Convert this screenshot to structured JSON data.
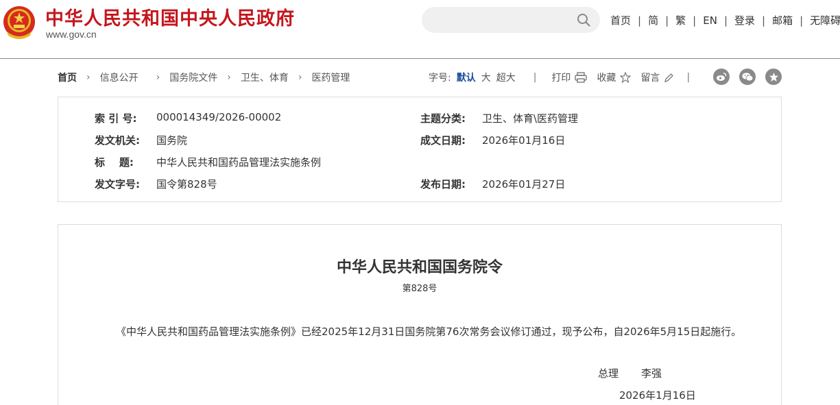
{
  "header": {
    "site_title": "中华人民共和国中央人民政府",
    "site_url": "www.gov.cn",
    "nav": [
      "首页",
      "简",
      "繁",
      "EN",
      "登录",
      "邮箱",
      "无障碍"
    ],
    "brand_color": "#c4161c"
  },
  "breadcrumb": [
    "首页",
    "信息公开",
    "国务院文件",
    "卫生、体育",
    "医药管理"
  ],
  "tools": {
    "font_size_label": "字号:",
    "font_sizes": [
      "默认",
      "大",
      "超大"
    ],
    "print_label": "打印",
    "favorite_label": "收藏",
    "comment_label": "留言",
    "share_icons": [
      "weibo-icon",
      "wechat-icon",
      "qzone-icon"
    ]
  },
  "info": {
    "index_label": "索 引 号:",
    "index_value": "000014349/2026-00002",
    "topic_label": "主题分类:",
    "topic_value": "卫生、体育\\医药管理",
    "issuer_label": "发文机关:",
    "issuer_value": "国务院",
    "created_label": "成文日期:",
    "created_value": "2026年01月16日",
    "title_label": "标    题:",
    "title_value": "中华人民共和国药品管理法实施条例",
    "docno_label": "发文字号:",
    "docno_value": "国令第828号",
    "published_label": "发布日期:",
    "published_value": "2026年01月27日"
  },
  "document": {
    "title": "中华人民共和国国务院令",
    "number": "第828号",
    "body": "《中华人民共和国药品管理法实施条例》已经2025年12月31日国务院第76次常务会议修订通过，现予公布，自2026年5月15日起施行。",
    "signer_role": "总理",
    "signer_name": "李强",
    "sign_date": "2026年1月16日"
  }
}
